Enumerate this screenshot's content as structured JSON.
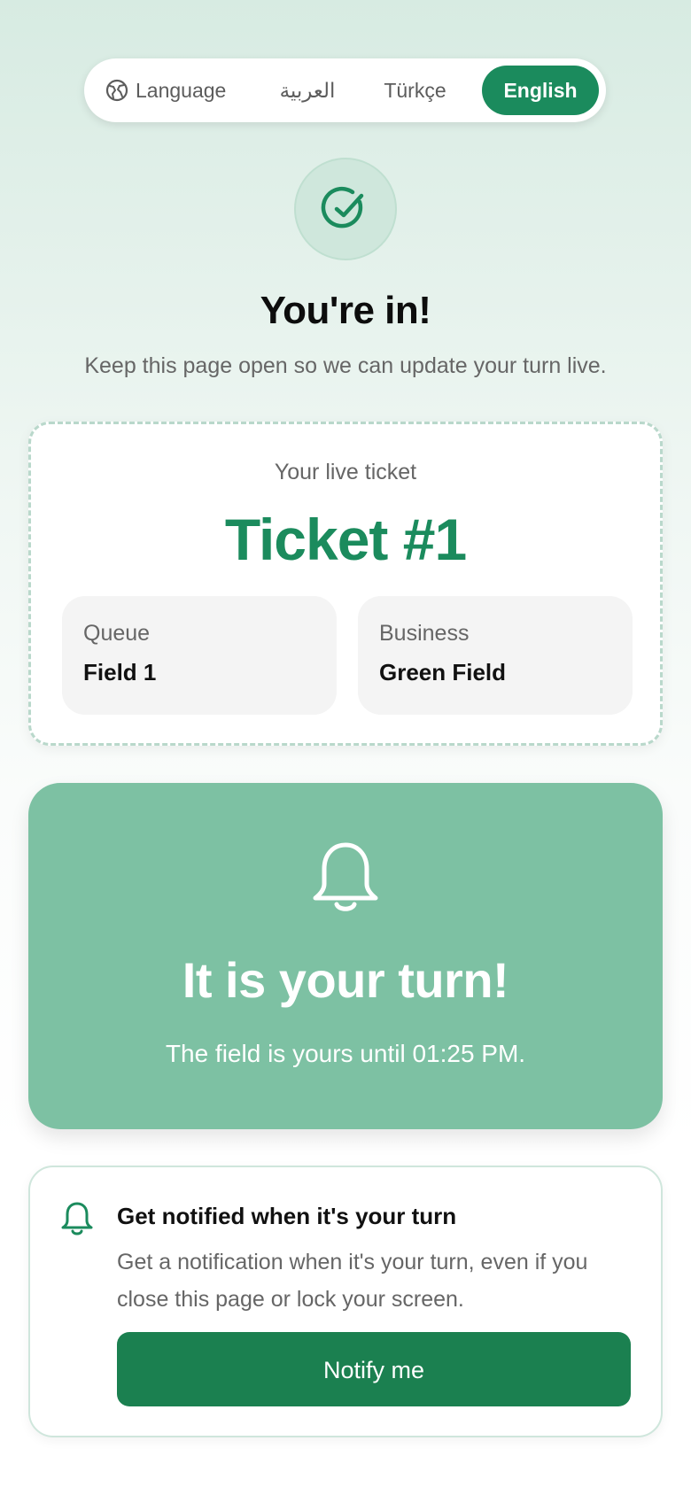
{
  "language_bar": {
    "label": "Language",
    "label_icon": "globe-icon",
    "options": [
      "العربية",
      "Türkçe",
      "English"
    ],
    "selected": "English"
  },
  "status": {
    "icon": "check-circle-icon",
    "title": "You're in!",
    "subtitle": "Keep this page open so we can update your turn live."
  },
  "ticket": {
    "caption": "Your live ticket",
    "number": "Ticket #1",
    "queue_label": "Queue",
    "queue_value": "Field 1",
    "business_label": "Business",
    "business_value": "Green Field"
  },
  "turn": {
    "icon": "bell-icon",
    "title": "It is your turn!",
    "message": "The field is yours until 01:25 PM."
  },
  "notify": {
    "icon": "bell-icon",
    "title": "Get notified when it's your turn",
    "description": "Get a notification when it's your turn, even if you close this page or lock your screen.",
    "button_label": "Notify me"
  },
  "colors": {
    "accent": "#1b8b5d",
    "turn_card": "#7dc1a3",
    "button": "#1b8050"
  }
}
